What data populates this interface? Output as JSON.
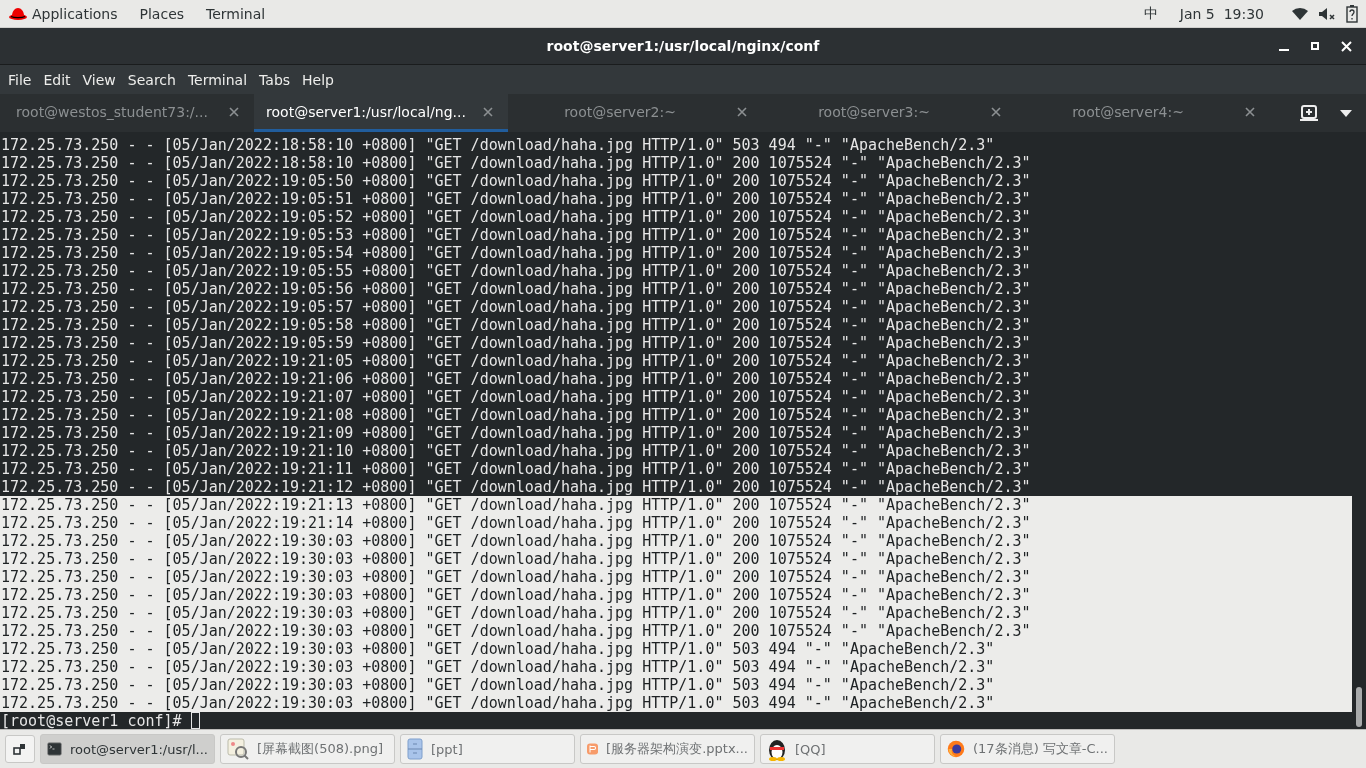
{
  "top_bar": {
    "menus": [
      "Applications",
      "Places",
      "Terminal"
    ],
    "input_method": "中",
    "clock": "Jan 5  19:30"
  },
  "window": {
    "title": "root@server1:/usr/local/nginx/conf"
  },
  "menubar": [
    "File",
    "Edit",
    "View",
    "Search",
    "Terminal",
    "Tabs",
    "Help"
  ],
  "tabs": [
    {
      "label": "root@westos_student73:/...",
      "selected": false
    },
    {
      "label": "root@server1:/usr/local/ng...",
      "selected": true
    },
    {
      "label": "root@server2:~",
      "selected": false
    },
    {
      "label": "root@server3:~",
      "selected": false
    },
    {
      "label": "root@server4:~",
      "selected": false
    }
  ],
  "terminal": {
    "lines": [
      {
        "text": "172.25.73.250 - - [05/Jan/2022:18:58:10 +0800] \"GET /download/haha.jpg HTTP/1.0\" 503 494 \"-\" \"ApacheBench/2.3\"",
        "selected": false
      },
      {
        "text": "172.25.73.250 - - [05/Jan/2022:18:58:10 +0800] \"GET /download/haha.jpg HTTP/1.0\" 200 1075524 \"-\" \"ApacheBench/2.3\"",
        "selected": false
      },
      {
        "text": "172.25.73.250 - - [05/Jan/2022:19:05:50 +0800] \"GET /download/haha.jpg HTTP/1.0\" 200 1075524 \"-\" \"ApacheBench/2.3\"",
        "selected": false
      },
      {
        "text": "172.25.73.250 - - [05/Jan/2022:19:05:51 +0800] \"GET /download/haha.jpg HTTP/1.0\" 200 1075524 \"-\" \"ApacheBench/2.3\"",
        "selected": false
      },
      {
        "text": "172.25.73.250 - - [05/Jan/2022:19:05:52 +0800] \"GET /download/haha.jpg HTTP/1.0\" 200 1075524 \"-\" \"ApacheBench/2.3\"",
        "selected": false
      },
      {
        "text": "172.25.73.250 - - [05/Jan/2022:19:05:53 +0800] \"GET /download/haha.jpg HTTP/1.0\" 200 1075524 \"-\" \"ApacheBench/2.3\"",
        "selected": false
      },
      {
        "text": "172.25.73.250 - - [05/Jan/2022:19:05:54 +0800] \"GET /download/haha.jpg HTTP/1.0\" 200 1075524 \"-\" \"ApacheBench/2.3\"",
        "selected": false
      },
      {
        "text": "172.25.73.250 - - [05/Jan/2022:19:05:55 +0800] \"GET /download/haha.jpg HTTP/1.0\" 200 1075524 \"-\" \"ApacheBench/2.3\"",
        "selected": false
      },
      {
        "text": "172.25.73.250 - - [05/Jan/2022:19:05:56 +0800] \"GET /download/haha.jpg HTTP/1.0\" 200 1075524 \"-\" \"ApacheBench/2.3\"",
        "selected": false
      },
      {
        "text": "172.25.73.250 - - [05/Jan/2022:19:05:57 +0800] \"GET /download/haha.jpg HTTP/1.0\" 200 1075524 \"-\" \"ApacheBench/2.3\"",
        "selected": false
      },
      {
        "text": "172.25.73.250 - - [05/Jan/2022:19:05:58 +0800] \"GET /download/haha.jpg HTTP/1.0\" 200 1075524 \"-\" \"ApacheBench/2.3\"",
        "selected": false
      },
      {
        "text": "172.25.73.250 - - [05/Jan/2022:19:05:59 +0800] \"GET /download/haha.jpg HTTP/1.0\" 200 1075524 \"-\" \"ApacheBench/2.3\"",
        "selected": false
      },
      {
        "text": "172.25.73.250 - - [05/Jan/2022:19:21:05 +0800] \"GET /download/haha.jpg HTTP/1.0\" 200 1075524 \"-\" \"ApacheBench/2.3\"",
        "selected": false
      },
      {
        "text": "172.25.73.250 - - [05/Jan/2022:19:21:06 +0800] \"GET /download/haha.jpg HTTP/1.0\" 200 1075524 \"-\" \"ApacheBench/2.3\"",
        "selected": false
      },
      {
        "text": "172.25.73.250 - - [05/Jan/2022:19:21:07 +0800] \"GET /download/haha.jpg HTTP/1.0\" 200 1075524 \"-\" \"ApacheBench/2.3\"",
        "selected": false
      },
      {
        "text": "172.25.73.250 - - [05/Jan/2022:19:21:08 +0800] \"GET /download/haha.jpg HTTP/1.0\" 200 1075524 \"-\" \"ApacheBench/2.3\"",
        "selected": false
      },
      {
        "text": "172.25.73.250 - - [05/Jan/2022:19:21:09 +0800] \"GET /download/haha.jpg HTTP/1.0\" 200 1075524 \"-\" \"ApacheBench/2.3\"",
        "selected": false
      },
      {
        "text": "172.25.73.250 - - [05/Jan/2022:19:21:10 +0800] \"GET /download/haha.jpg HTTP/1.0\" 200 1075524 \"-\" \"ApacheBench/2.3\"",
        "selected": false
      },
      {
        "text": "172.25.73.250 - - [05/Jan/2022:19:21:11 +0800] \"GET /download/haha.jpg HTTP/1.0\" 200 1075524 \"-\" \"ApacheBench/2.3\"",
        "selected": false
      },
      {
        "text": "172.25.73.250 - - [05/Jan/2022:19:21:12 +0800] \"GET /download/haha.jpg HTTP/1.0\" 200 1075524 \"-\" \"ApacheBench/2.3\"",
        "selected": false
      },
      {
        "text": "172.25.73.250 - - [05/Jan/2022:19:21:13 +0800] \"GET /download/haha.jpg HTTP/1.0\" 200 1075524 \"-\" \"ApacheBench/2.3\"",
        "selected": true
      },
      {
        "text": "172.25.73.250 - - [05/Jan/2022:19:21:14 +0800] \"GET /download/haha.jpg HTTP/1.0\" 200 1075524 \"-\" \"ApacheBench/2.3\"",
        "selected": true
      },
      {
        "text": "172.25.73.250 - - [05/Jan/2022:19:30:03 +0800] \"GET /download/haha.jpg HTTP/1.0\" 200 1075524 \"-\" \"ApacheBench/2.3\"",
        "selected": true
      },
      {
        "text": "172.25.73.250 - - [05/Jan/2022:19:30:03 +0800] \"GET /download/haha.jpg HTTP/1.0\" 200 1075524 \"-\" \"ApacheBench/2.3\"",
        "selected": true
      },
      {
        "text": "172.25.73.250 - - [05/Jan/2022:19:30:03 +0800] \"GET /download/haha.jpg HTTP/1.0\" 200 1075524 \"-\" \"ApacheBench/2.3\"",
        "selected": true
      },
      {
        "text": "172.25.73.250 - - [05/Jan/2022:19:30:03 +0800] \"GET /download/haha.jpg HTTP/1.0\" 200 1075524 \"-\" \"ApacheBench/2.3\"",
        "selected": true
      },
      {
        "text": "172.25.73.250 - - [05/Jan/2022:19:30:03 +0800] \"GET /download/haha.jpg HTTP/1.0\" 200 1075524 \"-\" \"ApacheBench/2.3\"",
        "selected": true
      },
      {
        "text": "172.25.73.250 - - [05/Jan/2022:19:30:03 +0800] \"GET /download/haha.jpg HTTP/1.0\" 200 1075524 \"-\" \"ApacheBench/2.3\"",
        "selected": true
      },
      {
        "text": "172.25.73.250 - - [05/Jan/2022:19:30:03 +0800] \"GET /download/haha.jpg HTTP/1.0\" 503 494 \"-\" \"ApacheBench/2.3\"",
        "selected": true
      },
      {
        "text": "172.25.73.250 - - [05/Jan/2022:19:30:03 +0800] \"GET /download/haha.jpg HTTP/1.0\" 503 494 \"-\" \"ApacheBench/2.3\"",
        "selected": true
      },
      {
        "text": "172.25.73.250 - - [05/Jan/2022:19:30:03 +0800] \"GET /download/haha.jpg HTTP/1.0\" 503 494 \"-\" \"ApacheBench/2.3\"",
        "selected": true
      },
      {
        "text": "172.25.73.250 - - [05/Jan/2022:19:30:03 +0800] \"GET /download/haha.jpg HTTP/1.0\" 503 494 \"-\" \"ApacheBench/2.3\"",
        "selected": true
      }
    ],
    "prompt": "[root@server1 conf]#"
  },
  "taskbar": [
    {
      "kind": "terminal",
      "label": "root@server1:/usr/l...",
      "selected": true
    },
    {
      "kind": "image",
      "label": "[屏幕截图(508).png]",
      "selected": false
    },
    {
      "kind": "folder",
      "label": "[ppt]",
      "selected": false
    },
    {
      "kind": "slides",
      "label": "[服务器架构演变.pptx...",
      "selected": false
    },
    {
      "kind": "penguin",
      "label": "[QQ]",
      "selected": false
    },
    {
      "kind": "browser",
      "label": "(17条消息) 写文章-C...",
      "selected": false
    }
  ]
}
